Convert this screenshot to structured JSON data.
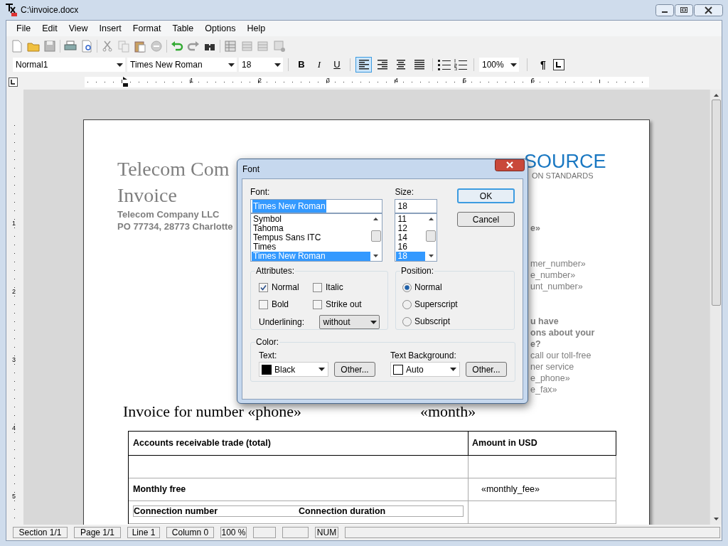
{
  "window": {
    "title": "C:\\invoice.docx"
  },
  "menu": [
    "File",
    "Edit",
    "View",
    "Insert",
    "Format",
    "Table",
    "Options",
    "Help"
  ],
  "format_bar": {
    "style": "Normal1",
    "font": "Times New Roman",
    "size": "18",
    "zoom": "100%",
    "text_buttons": [
      {
        "label": "B",
        "kind": "bold"
      },
      {
        "label": "I",
        "kind": "italic"
      },
      {
        "label": "U",
        "kind": "underline"
      }
    ],
    "alignment": [
      {
        "kind": "left",
        "selected": true
      },
      {
        "kind": "right",
        "selected": false
      },
      {
        "kind": "center",
        "selected": false
      },
      {
        "kind": "justify",
        "selected": false
      }
    ],
    "pilcrow": "¶"
  },
  "ruler": {
    "numbers": [
      "1",
      "2",
      "3",
      "4",
      "5",
      "6"
    ]
  },
  "vertical_ruler": {
    "numbers": [
      "1",
      "2",
      "3",
      "4",
      "5"
    ]
  },
  "document": {
    "heading": [
      "Telecom Com",
      "Invoice"
    ],
    "company": [
      "Telecom Company LLC",
      "PO 77734, 28773 Charlotte"
    ],
    "logo": {
      "name": "SOURCE",
      "tagline": "ON STANDARDS"
    },
    "right_column": [
      [
        {
          "text": "e»",
          "bold": true
        }
      ],
      [
        {
          "text": "mer_number»",
          "bold": false
        },
        {
          "text": "e_number»",
          "bold": false
        },
        {
          "text": "unt_number»",
          "bold": false
        }
      ],
      [
        {
          "text": "u have",
          "bold": true
        },
        {
          "text": "ons about your",
          "bold": true
        },
        {
          "text": "e?",
          "bold": true
        },
        {
          "text": "call our toll-free",
          "bold": false
        },
        {
          "text": "ner service",
          "bold": false
        },
        {
          "text": "e_phone»",
          "bold": false
        },
        {
          "text": "e_fax»",
          "bold": false
        }
      ]
    ],
    "invoice_line": [
      "Invoice for number «phone»",
      "«month»"
    ]
  },
  "table": {
    "columns": [
      "Accounts  receivable trade (total)",
      "Amount in USD"
    ],
    "rows": [
      {
        "kind": "empty"
      },
      {
        "kind": "item",
        "label": "Monthly free",
        "amount": "«monthly_fee»"
      },
      {
        "kind": "nested",
        "cells": [
          "Connection number",
          "Connection duration"
        ]
      }
    ]
  },
  "status_bar": [
    {
      "kind": "text",
      "text": "Section 1/1"
    },
    {
      "kind": "text",
      "text": "Page 1/1"
    },
    {
      "kind": "text",
      "text": "Line 1"
    },
    {
      "kind": "text",
      "text": "Column 0"
    },
    {
      "kind": "text",
      "text": "100 %"
    },
    {
      "kind": "empty"
    },
    {
      "kind": "empty"
    },
    {
      "kind": "text",
      "text": "NUM"
    },
    {
      "kind": "fill"
    }
  ],
  "font_dialog": {
    "title": "Font",
    "font_label": "Font:",
    "font_value": "Times New Roman",
    "fonts": [
      {
        "name": "Symbol",
        "selected": false
      },
      {
        "name": "Tahoma",
        "selected": false
      },
      {
        "name": "Tempus Sans ITC",
        "selected": false
      },
      {
        "name": "Times",
        "selected": false
      },
      {
        "name": "Times New Roman",
        "selected": true
      }
    ],
    "size_label": "Size:",
    "size_value": "18",
    "sizes": [
      {
        "name": "11",
        "selected": false
      },
      {
        "name": "12",
        "selected": false
      },
      {
        "name": "14",
        "selected": false
      },
      {
        "name": "16",
        "selected": false
      },
      {
        "name": "18",
        "selected": true
      }
    ],
    "ok": "OK",
    "cancel": "Cancel",
    "attributes_label": "Attributes:",
    "attributes": [
      {
        "label": "Normal",
        "checked": true
      },
      {
        "label": "Italic",
        "checked": false
      },
      {
        "label": "Bold",
        "checked": false
      },
      {
        "label": "Strike out",
        "checked": false
      }
    ],
    "underlining_label": "Underlining:",
    "underlining": "without",
    "position_label": "Position:",
    "positions": [
      {
        "label": "Normal",
        "selected": true
      },
      {
        "label": "Superscript",
        "selected": false
      },
      {
        "label": "Subscript",
        "selected": false
      }
    ],
    "color_label": "Color:",
    "text_label": "Text:",
    "text_color": {
      "name": "Black",
      "color": "#000000"
    },
    "background_label": "Text Background:",
    "background_color": {
      "name": "Auto",
      "color": "#ffffff"
    },
    "other_buttons": [
      "Other...",
      "Other..."
    ]
  }
}
